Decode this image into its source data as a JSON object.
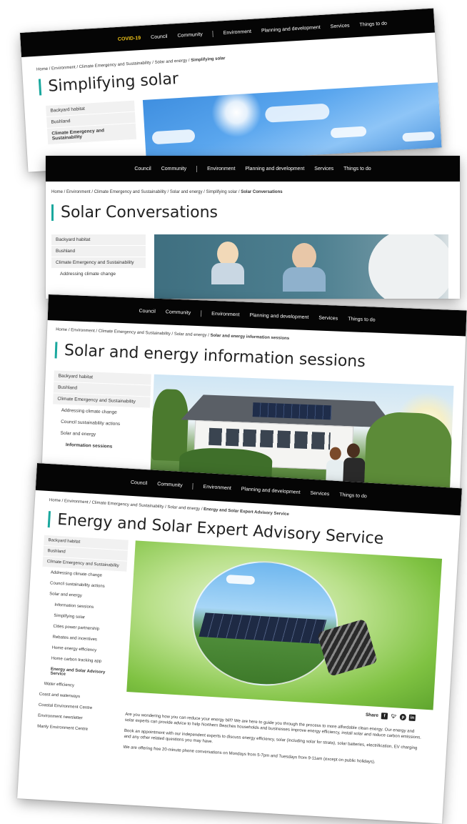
{
  "cards": [
    {
      "nav": [
        "COVID-19",
        "Council",
        "Community",
        "Environment",
        "Planning and development",
        "Services",
        "Things to do"
      ],
      "breadcrumb": [
        "Home",
        "Environment",
        "Climate Emergency and Sustainability",
        "Solar and energy"
      ],
      "breadcrumb_current": "Simplifying solar",
      "title": "Simplifying solar",
      "sidebar": [
        "Backyard habitat",
        "Bushland",
        "Climate Emergency and Sustainability"
      ]
    },
    {
      "nav": [
        "Council",
        "Community",
        "Environment",
        "Planning and development",
        "Services",
        "Things to do"
      ],
      "breadcrumb": [
        "Home",
        "Environment",
        "Climate Emergency and Sustainability",
        "Solar and energy",
        "Simplifying solar"
      ],
      "breadcrumb_current": "Solar Conversations",
      "title": "Solar Conversations",
      "sidebar": [
        "Backyard habitat",
        "Bushland",
        "Climate Emergency and Sustainability",
        "Addressing climate change"
      ]
    },
    {
      "nav": [
        "Council",
        "Community",
        "Environment",
        "Planning and development",
        "Services",
        "Things to do"
      ],
      "breadcrumb": [
        "Home",
        "Environment",
        "Climate Emergency and Sustainability",
        "Solar and energy"
      ],
      "breadcrumb_current": "Solar and energy information sessions",
      "title": "Solar and energy information sessions",
      "sidebar": [
        "Backyard habitat",
        "Bushland",
        "Climate Emergency and Sustainability",
        "Addressing climate change",
        "Council sustainability actions",
        "Solar and energy",
        "Information sessions"
      ]
    },
    {
      "nav": [
        "Council",
        "Community",
        "Environment",
        "Planning and development",
        "Services",
        "Things to do"
      ],
      "breadcrumb": [
        "Home",
        "Environment",
        "Climate Emergency and Sustainability",
        "Solar and energy"
      ],
      "breadcrumb_current": "Energy and Solar Expert Advisory Service",
      "title": "Energy and Solar Expert Advisory Service",
      "sidebar": [
        "Backyard habitat",
        "Bushland",
        "Climate Emergency and Sustainability",
        "Addressing climate change",
        "Council sustainability actions",
        "Solar and energy",
        "Information sessions",
        "Simplifying solar",
        "Cities power partnership",
        "Rebates and incentives",
        "Home energy efficiency",
        "Home carbon tracking app",
        "Energy and Solar Advisory Service",
        "Water efficiency",
        "Coast and waterways",
        "Coastal Environment Centre",
        "Environment newsletter",
        "Manly Environment Centre"
      ],
      "share_label": "Share",
      "share_icons": [
        "facebook-icon",
        "twitter-icon",
        "pinterest-icon",
        "linkedin-icon"
      ],
      "paragraphs": [
        "Are you wondering how you can reduce your energy bill? We are here to guide you through the process to more affordable clean energy. Our energy and solar experts can provide advice to help Northern Beaches households and businesses improve energy efficiency, install solar and reduce carbon emissions.",
        "Book an appointment with our independent experts to discuss energy efficiency, solar (including solar for strata), solar batteries, electrification, EV charging and any other related questions you may have.",
        "We are offering free 20-minute phone conversations on Mondays from 5-7pm and Tuesdays from 9-11am (except on public holidays)."
      ]
    }
  ],
  "colors": {
    "accent": "#1aa89e",
    "nav_bg": "#050505",
    "covid": "#f0c419"
  }
}
